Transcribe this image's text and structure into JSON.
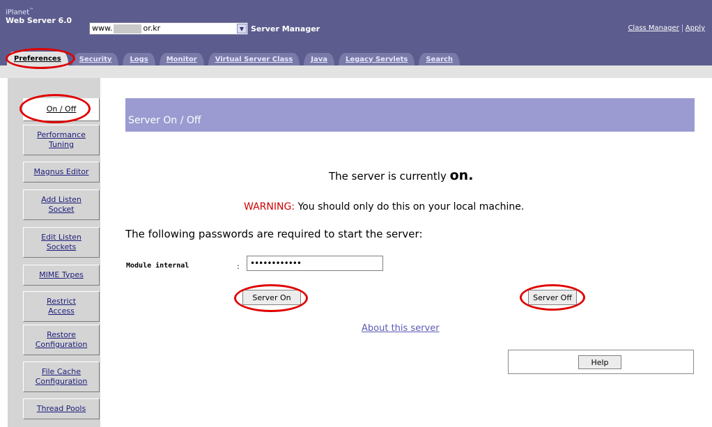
{
  "header": {
    "brand_line1": "iPlanet",
    "brand_tm": "™",
    "brand_line2": "Web Server 6.0",
    "server_prefix": "www.",
    "server_suffix": "or.kr",
    "server_manager_label": "Server Manager",
    "class_manager_link": "Class Manager",
    "apply_link": "Apply"
  },
  "tabs": [
    {
      "label": "Preferences",
      "active": true
    },
    {
      "label": "Security"
    },
    {
      "label": "Logs"
    },
    {
      "label": "Monitor"
    },
    {
      "label": "Virtual Server Class"
    },
    {
      "label": "Java"
    },
    {
      "label": "Legacy Servlets"
    },
    {
      "label": "Search"
    }
  ],
  "sidebar": {
    "items": [
      {
        "label": "On / Off",
        "active": true
      },
      {
        "label": "Performance\nTuning"
      },
      {
        "label": "Magnus Editor"
      },
      {
        "label": "Add Listen\nSocket"
      },
      {
        "label": "Edit Listen\nSockets"
      },
      {
        "label": "MIME Types"
      },
      {
        "label": "Restrict\nAccess"
      },
      {
        "label": "Restore\nConfiguration"
      },
      {
        "label": "File Cache\nConfiguration"
      },
      {
        "label": "Thread Pools"
      }
    ]
  },
  "main": {
    "title": "Server On / Off",
    "status_prefix": "The server is currently",
    "status_value": "on.",
    "warning_label": "WARNING:",
    "warning_text": " You should only do this on your local machine.",
    "password_heading": "The following passwords are required to start the server:",
    "module_label": "Module internal",
    "colon": ":",
    "password_value": "••••••••••••",
    "server_on_button": "Server On",
    "server_off_button": "Server Off",
    "about_link": "About this server",
    "help_button": "Help"
  },
  "colors": {
    "header_bg": "#5c5c8e",
    "title_bar": "#9b9bd1",
    "warning": "#cc0000",
    "annotation_ring": "#e00000"
  }
}
